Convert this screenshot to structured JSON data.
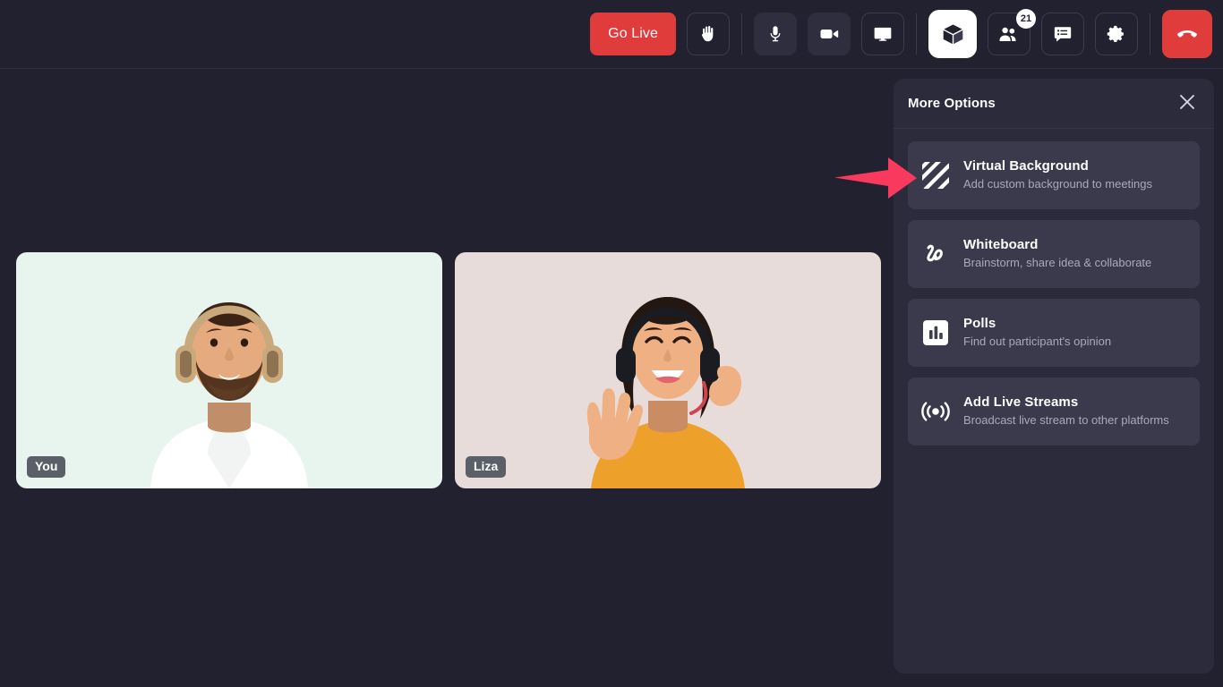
{
  "toolbar": {
    "go_live_label": "Go Live",
    "buttons": [
      {
        "name": "raise-hand-button",
        "icon": "hand-icon",
        "tooltip": "Raise Hand"
      },
      {
        "name": "microphone-button",
        "icon": "microphone-icon",
        "tooltip": "Mute"
      },
      {
        "name": "camera-button",
        "icon": "video-camera-icon",
        "tooltip": "Stop Video"
      },
      {
        "name": "share-screen-button",
        "icon": "screen-share-icon",
        "tooltip": "Share Screen"
      },
      {
        "name": "more-options-button",
        "icon": "cube-icon",
        "tooltip": "More Options"
      },
      {
        "name": "participants-button",
        "icon": "people-icon",
        "tooltip": "Participants"
      },
      {
        "name": "chat-button",
        "icon": "chat-bubble-icon",
        "tooltip": "Chat"
      },
      {
        "name": "settings-button",
        "icon": "gear-icon",
        "tooltip": "Settings"
      },
      {
        "name": "end-call-button",
        "icon": "phone-hangup-icon",
        "tooltip": "Leave"
      }
    ],
    "participants_count": "21"
  },
  "stage": {
    "tiles": [
      {
        "name": "You",
        "background_color": "#e8f5ef"
      },
      {
        "name": "Liza",
        "background_color": "#e8dcda"
      }
    ]
  },
  "panel": {
    "title": "More Options",
    "close_icon": "close-icon",
    "options": [
      {
        "title": "Virtual Background",
        "subtitle": "Add custom background to meetings",
        "icon": "diagonal-stripes-icon"
      },
      {
        "title": "Whiteboard",
        "subtitle": "Brainstorm, share idea & collaborate",
        "icon": "scribble-icon"
      },
      {
        "title": "Polls",
        "subtitle": "Find out participant's opinion",
        "icon": "bar-chart-icon"
      },
      {
        "title": "Add Live Streams",
        "subtitle": "Broadcast live stream to other platforms",
        "icon": "broadcast-icon"
      }
    ]
  },
  "annotation": {
    "arrow_color": "#f93a5e",
    "points_to": "Virtual Background"
  },
  "colors": {
    "background": "#21212f",
    "panel": "#2b2b3b",
    "option_card": "#3a3a4c",
    "danger": "#e03c3c",
    "accent_arrow": "#f93a5e",
    "text_primary": "#ffffff",
    "text_secondary": "#a9a9b8"
  }
}
